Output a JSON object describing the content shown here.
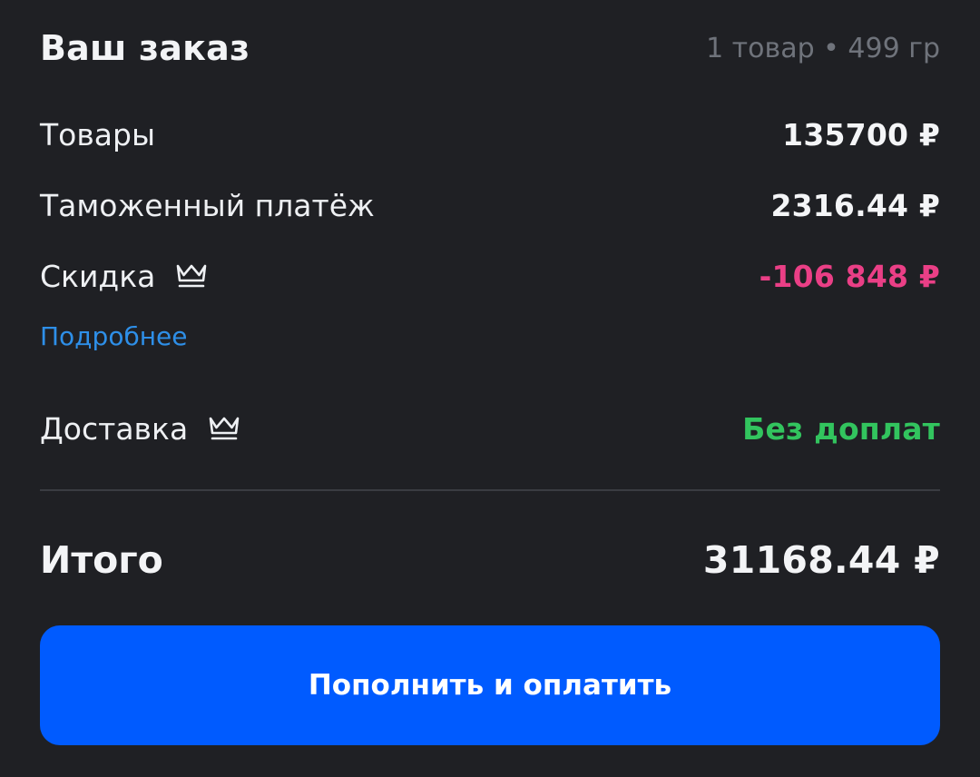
{
  "order": {
    "title": "Ваш заказ",
    "summary": "1 товар • 499 гр"
  },
  "lines": {
    "goods_label": "Товары",
    "goods_value": "135700 ₽",
    "customs_label": "Таможенный платёж",
    "customs_value": "2316.44 ₽",
    "discount_label": "Скидка",
    "discount_value": "-106 848 ₽",
    "details_link": "Подробнее",
    "delivery_label": "Доставка",
    "delivery_value": "Без доплат"
  },
  "total": {
    "label": "Итого",
    "value": "31168.44 ₽"
  },
  "actions": {
    "pay_label": "Пополнить и оплатить"
  },
  "icons": {
    "discount_icon": "crown-icon",
    "delivery_icon": "crown-icon"
  },
  "colors": {
    "background": "#1f2024",
    "discount": "#ea3f86",
    "delivery": "#32c45e",
    "link": "#2e8fe8",
    "button": "#005bff"
  }
}
